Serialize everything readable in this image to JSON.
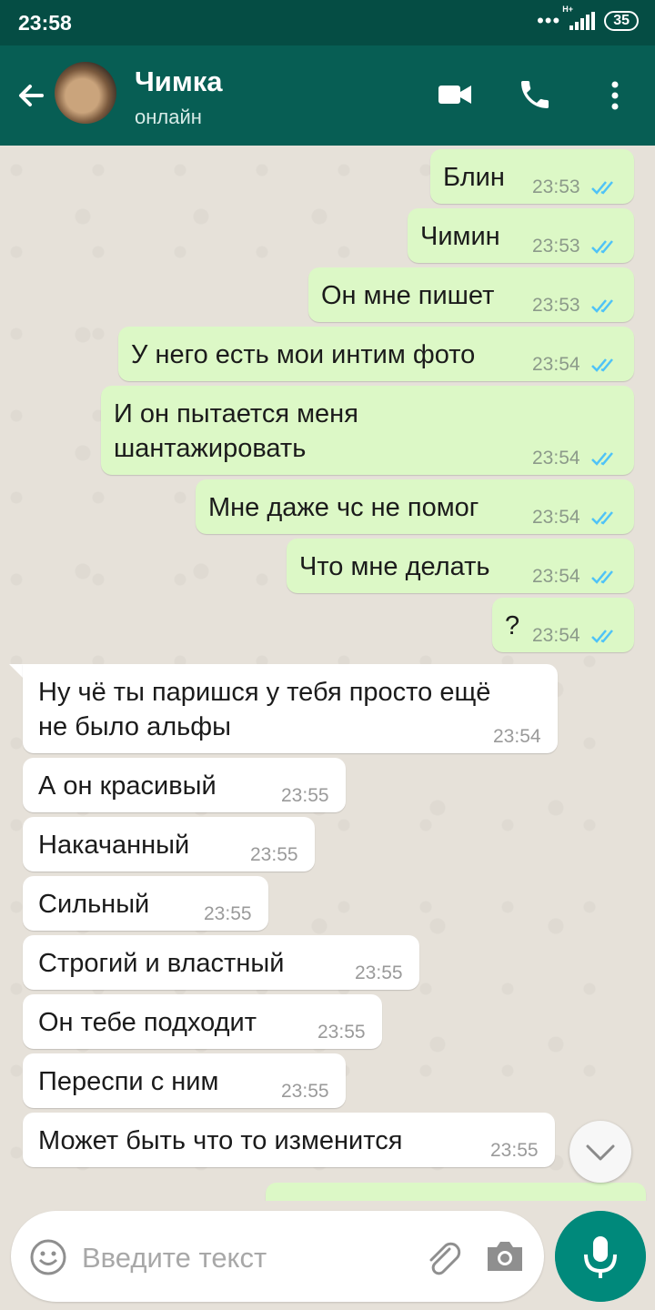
{
  "status_bar": {
    "time": "23:58",
    "network": "H+",
    "battery": "35"
  },
  "header": {
    "name": "Чимка",
    "status": "онлайн"
  },
  "messages": [
    {
      "dir": "out",
      "text": "Блин",
      "time": "23:53"
    },
    {
      "dir": "out",
      "text": "Чимин",
      "time": "23:53"
    },
    {
      "dir": "out",
      "text": "Он мне пишет",
      "time": "23:53"
    },
    {
      "dir": "out",
      "text": "У него есть мои интим фото",
      "time": "23:54"
    },
    {
      "dir": "out",
      "text": "И он пытается меня\nшантажировать",
      "time": "23:54"
    },
    {
      "dir": "out",
      "text": "Мне даже чс не помог",
      "time": "23:54"
    },
    {
      "dir": "out",
      "text": "Что мне делать",
      "time": "23:54"
    },
    {
      "dir": "out",
      "text": "?",
      "time": "23:54"
    },
    {
      "dir": "in",
      "text": "Ну чё ты паришся у тебя просто ещё\nне было альфы",
      "time": "23:54"
    },
    {
      "dir": "in",
      "text": "А он красивый",
      "time": "23:55"
    },
    {
      "dir": "in",
      "text": "Накачанный",
      "time": "23:55"
    },
    {
      "dir": "in",
      "text": "Сильный",
      "time": "23:55"
    },
    {
      "dir": "in",
      "text": "Строгий и властный",
      "time": "23:55"
    },
    {
      "dir": "in",
      "text": "Он тебе подходит",
      "time": "23:55"
    },
    {
      "dir": "in",
      "text": "Переспи с ним",
      "time": "23:55"
    },
    {
      "dir": "in",
      "text": "Может быть что то изменится",
      "time": "23:55"
    }
  ],
  "composer": {
    "placeholder": "Введите текст"
  },
  "colors": {
    "header": "#075e54",
    "status_bar": "#054d44",
    "outgoing": "#dcf8c6",
    "incoming": "#ffffff",
    "read_tick": "#4fc3f7",
    "mic": "#00897b"
  },
  "icons": {
    "back": "arrow-left-icon",
    "video": "video-camera-icon",
    "call": "phone-icon",
    "menu": "more-vert-icon",
    "emoji": "emoji-icon",
    "attach": "paperclip-icon",
    "camera": "camera-icon",
    "mic": "mic-icon",
    "scroll": "chevron-down-icon"
  }
}
